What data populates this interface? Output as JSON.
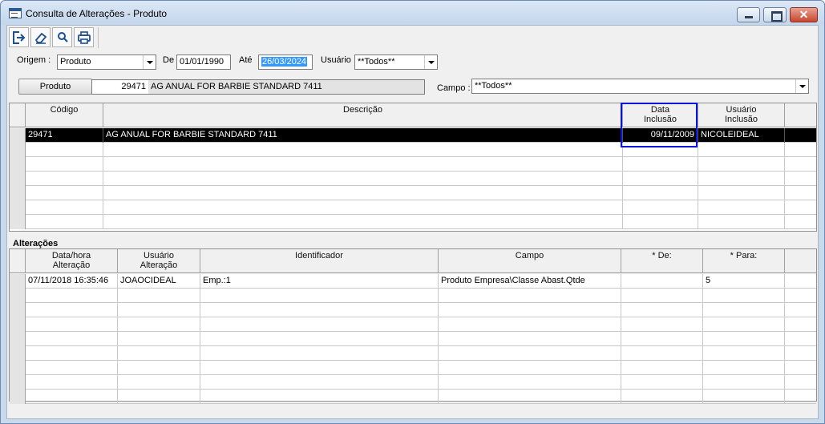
{
  "window": {
    "title": "Consulta de Alterações - Produto"
  },
  "toolbar": {
    "buttons": [
      "exit-icon",
      "eraser-icon",
      "search-icon",
      "print-icon"
    ]
  },
  "filters": {
    "origem_label": "Origem :",
    "origem_value": "Produto",
    "de_label": "De",
    "de_value": "01/01/1990",
    "ate_label": "Até",
    "ate_value": "26/03/2024",
    "usuario_label": "Usuário",
    "usuario_value": "**Todos**",
    "produto_button": "Produto",
    "produto_code": "29471",
    "produto_desc": "AG ANUAL FOR BARBIE STANDARD 7411",
    "campo_label": "Campo :",
    "campo_value": "**Todos**"
  },
  "produtos_grid": {
    "headers": [
      "Código",
      "Descrição",
      "Data\nInclusão",
      "Usuário\nInclusão"
    ],
    "header_codigo": "Código",
    "header_descricao": "Descrição",
    "header_data_1": "Data",
    "header_data_2": "Inclusão",
    "header_usuario_1": "Usuário",
    "header_usuario_2": "Inclusão",
    "rows": [
      {
        "codigo": "29471",
        "descricao": "AG ANUAL FOR BARBIE STANDARD 7411",
        "data_inclusao": "09/11/2009",
        "usuario_inclusao": "NICOLEIDEAL"
      }
    ]
  },
  "alteracoes": {
    "section_title": "Alterações",
    "header_datahora_1": "Data/hora",
    "header_datahora_2": "Alteração",
    "header_usuario_1": "Usuário",
    "header_usuario_2": "Alteração",
    "header_identificador": "Identificador",
    "header_campo": "Campo",
    "header_de": "* De:",
    "header_para": "* Para:",
    "rows": [
      {
        "data_hora": "07/11/2018 16:35:46",
        "usuario": "JOAOCIDEAL",
        "identificador": "Emp.:1",
        "campo": "Produto Empresa\\Classe Abast.Qtde",
        "de": "",
        "para": "5"
      }
    ]
  },
  "colors": {
    "title_bg": "#c4d6ec",
    "selected_row": "#000000",
    "highlight_border": "#0a14d8",
    "date_selection": "#3399ff"
  }
}
